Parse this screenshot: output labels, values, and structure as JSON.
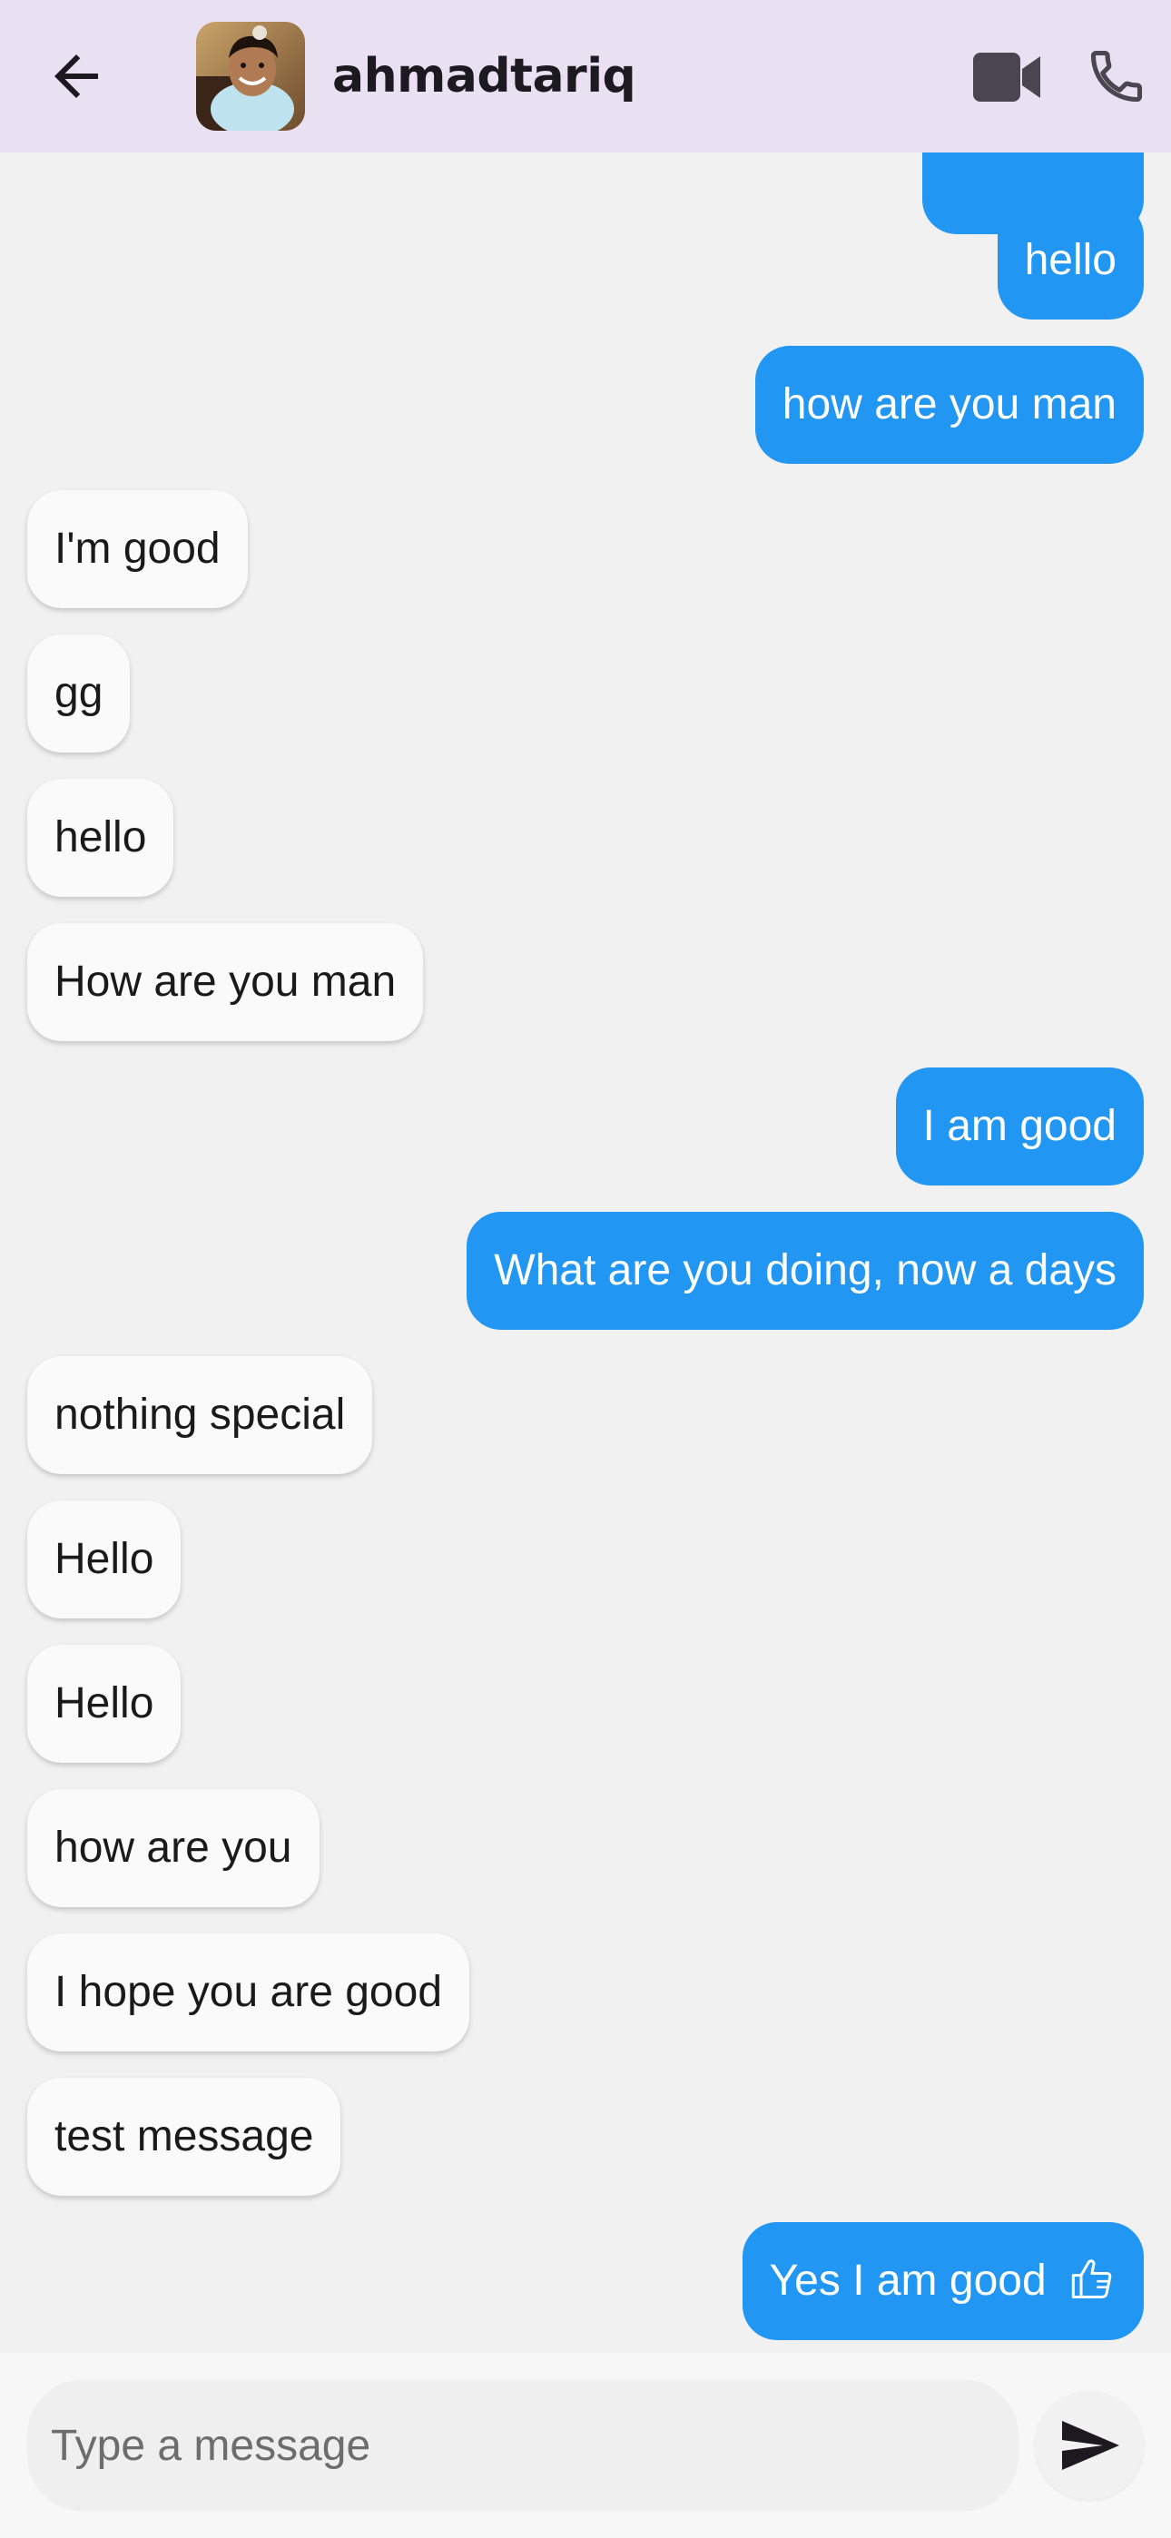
{
  "header": {
    "contact_name": "ahmadtariq",
    "icons": [
      "back-arrow-icon",
      "video-camera-icon",
      "phone-icon"
    ],
    "background_color": "#e9e0f1"
  },
  "messages": [
    {
      "direction": "outgoing",
      "text": "hello"
    },
    {
      "direction": "outgoing",
      "text": "how are you man"
    },
    {
      "direction": "incoming",
      "text": "I'm good"
    },
    {
      "direction": "incoming",
      "text": "gg"
    },
    {
      "direction": "incoming",
      "text": "hello"
    },
    {
      "direction": "incoming",
      "text": "How are you man"
    },
    {
      "direction": "outgoing",
      "text": "I am good"
    },
    {
      "direction": "outgoing",
      "text": "What are you doing, now a days"
    },
    {
      "direction": "incoming",
      "text": "nothing special"
    },
    {
      "direction": "incoming",
      "text": "Hello"
    },
    {
      "direction": "incoming",
      "text": "Hello"
    },
    {
      "direction": "incoming",
      "text": "how are you"
    },
    {
      "direction": "incoming",
      "text": "I hope you are good"
    },
    {
      "direction": "incoming",
      "text": "test message"
    },
    {
      "direction": "outgoing",
      "text": "Yes I am good",
      "emoji_icon": "thumbs-up-icon"
    }
  ],
  "composer": {
    "placeholder": "Type a message",
    "value": "",
    "send_icon": "send-icon"
  },
  "colors": {
    "outgoing_bubble": "#2196f3",
    "incoming_bubble": "#fafafa",
    "chat_background": "#f1f1f1"
  }
}
